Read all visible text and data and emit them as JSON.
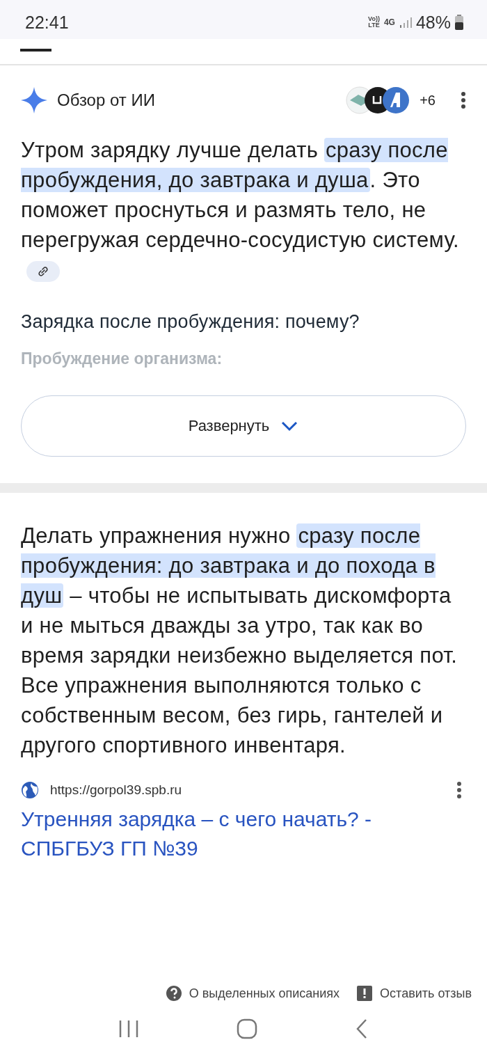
{
  "status_bar": {
    "time": "22:41",
    "network_volte": "Vo))\nLTE",
    "network_type": "4G",
    "battery": "48%"
  },
  "ai_overview": {
    "title": "Обзор от ИИ",
    "sources_count": "+6",
    "summary": [
      {
        "text": "Утром зарядку лучше делать ",
        "highlighted": false
      },
      {
        "text": "сразу после пробуждения, до завтрака и душа",
        "highlighted": true
      },
      {
        "text": ". Это поможет проснуться и размять тело, не перегружая сердечно-сосудистую систему.",
        "highlighted": false
      }
    ],
    "heading": "Зарядка после пробуждения: почему?",
    "faded_subheading": "Пробуждение организма:",
    "expand_button": "Развернуть"
  },
  "featured_snippet": {
    "text": [
      {
        "text": "Делать упражнения нужно ",
        "highlighted": false
      },
      {
        "text": "сразу после пробуждения: до завтрака и до похода в душ",
        "highlighted": true
      },
      {
        "text": " – чтобы не испытывать дискомфорта и не мыться дважды за утро, так как во время зарядки неизбежно выделяется пот. Все упражнения выполняются только с собственным весом, без гирь, гантелей и другого спортивного инвентаря.",
        "highlighted": false
      }
    ],
    "source_url": "https://gorpol39.spb.ru",
    "source_title": "Утренняя зарядка – с чего начать? - СПБГБУЗ ГП №39"
  },
  "footer_links": [
    {
      "kind": "help",
      "label": "О выделенных описаниях"
    },
    {
      "kind": "feedback",
      "label": "Оставить отзыв"
    }
  ]
}
